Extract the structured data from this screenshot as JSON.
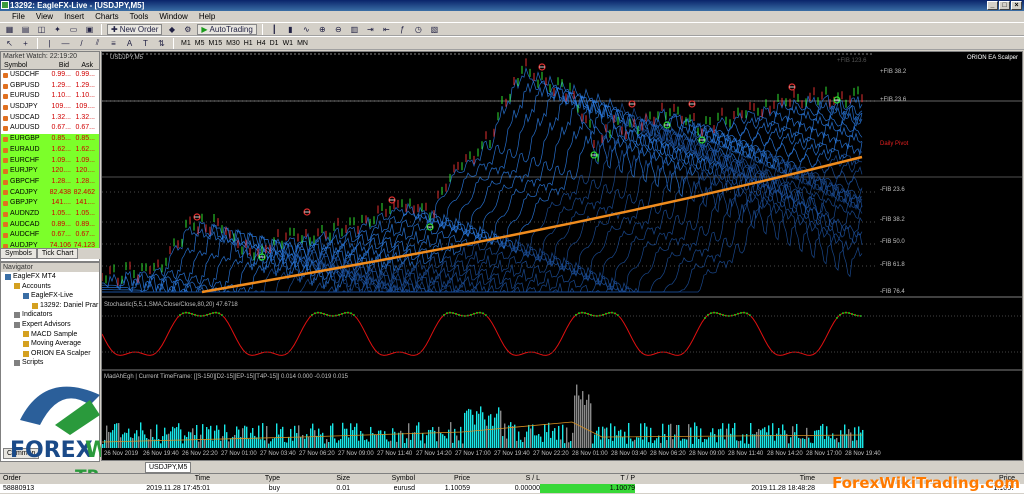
{
  "window": {
    "title": "13292: EagleFX-Live - [USDJPY,M5]"
  },
  "menu": [
    "File",
    "View",
    "Insert",
    "Charts",
    "Tools",
    "Window",
    "Help"
  ],
  "toolbar": {
    "new_order": "New Order",
    "autotrading": "AutoTrading",
    "timeframes": [
      "M1",
      "M5",
      "M15",
      "M30",
      "H1",
      "H4",
      "D1",
      "W1",
      "MN"
    ]
  },
  "market_watch": {
    "title": "Market Watch: 22:19:20",
    "columns": {
      "symbol": "Symbol",
      "bid": "Bid",
      "ask": "Ask"
    },
    "rows": [
      {
        "symbol": "USDCHF",
        "bid": "0.99...",
        "ask": "0.99...",
        "hl": false
      },
      {
        "symbol": "GBPUSD",
        "bid": "1.29...",
        "ask": "1.29...",
        "hl": false
      },
      {
        "symbol": "EURUSD",
        "bid": "1.10...",
        "ask": "1.10...",
        "hl": false
      },
      {
        "symbol": "USDJPY",
        "bid": "109....",
        "ask": "109....",
        "hl": false
      },
      {
        "symbol": "USDCAD",
        "bid": "1.32...",
        "ask": "1.32...",
        "hl": false
      },
      {
        "symbol": "AUDUSD",
        "bid": "0.67...",
        "ask": "0.67...",
        "hl": false
      },
      {
        "symbol": "EURGBP",
        "bid": "0.85...",
        "ask": "0.85...",
        "hl": true
      },
      {
        "symbol": "EURAUD",
        "bid": "1.62...",
        "ask": "1.62...",
        "hl": true
      },
      {
        "symbol": "EURCHF",
        "bid": "1.09...",
        "ask": "1.09...",
        "hl": true
      },
      {
        "symbol": "EURJPY",
        "bid": "120....",
        "ask": "120....",
        "hl": true
      },
      {
        "symbol": "GBPCHF",
        "bid": "1.28...",
        "ask": "1.28...",
        "hl": true
      },
      {
        "symbol": "CADJPY",
        "bid": "82.438",
        "ask": "82.462",
        "hl": true
      },
      {
        "symbol": "GBPJPY",
        "bid": "141....",
        "ask": "141....",
        "hl": true
      },
      {
        "symbol": "AUDNZD",
        "bid": "1.05...",
        "ask": "1.05...",
        "hl": true
      },
      {
        "symbol": "AUDCAD",
        "bid": "0.89...",
        "ask": "0.89...",
        "hl": true
      },
      {
        "symbol": "AUDCHF",
        "bid": "0.67...",
        "ask": "0.67...",
        "hl": true
      },
      {
        "symbol": "AUDJPY",
        "bid": "74.106",
        "ask": "74.123",
        "hl": true
      }
    ],
    "tabs": [
      "Symbols",
      "Tick Chart"
    ]
  },
  "navigator": {
    "title": "Navigator",
    "items": [
      {
        "label": "EagleFX MT4",
        "indent": 0
      },
      {
        "label": "Accounts",
        "indent": 1
      },
      {
        "label": "EagleFX-Live",
        "indent": 2
      },
      {
        "label": "13292: Daniel Prar",
        "indent": 3
      },
      {
        "label": "Indicators",
        "indent": 1
      },
      {
        "label": "Expert Advisors",
        "indent": 1
      },
      {
        "label": "MACD Sample",
        "indent": 2
      },
      {
        "label": "Moving Average",
        "indent": 2
      },
      {
        "label": "ORION EA Scalper",
        "indent": 2
      },
      {
        "label": "Scripts",
        "indent": 1
      }
    ],
    "tab": "Common"
  },
  "logo": {
    "text1": "FOREX",
    "text2": "WIKI",
    "text3": "TRADING"
  },
  "chart": {
    "symbol_label": "USDJPY,M5",
    "ea_label": "ORION EA Scalper",
    "daily_pivot": "Daily Pivot",
    "fib_labels": [
      "+FIB 123.6",
      "+FIB 38.2",
      "+FIB 23.6",
      "-FIB 23.6",
      "-FIB 38.2",
      "-FIB 50.0",
      "-FIB 61.8",
      "-FIB 76.4"
    ],
    "stoch_label": "Stochastic(5,5,1,SMA,Close/Close,80,20) 47.6718",
    "subwin_label": "MadAhEgh | Current TimeFrame: [[S-150][D2-15][EP-15][T4P-15]] 0.014 0.000 -0.019 0.015",
    "time_labels": [
      "26 Nov 2019",
      "26 Nov 19:40",
      "26 Nov 22:20",
      "27 Nov 01:00",
      "27 Nov 03:40",
      "27 Nov 06:20",
      "27 Nov 09:00",
      "27 Nov 11:40",
      "27 Nov 14:20",
      "27 Nov 17:00",
      "27 Nov 19:40",
      "27 Nov 22:20",
      "28 Nov 01:00",
      "28 Nov 03:40",
      "28 Nov 06:20",
      "28 Nov 09:00",
      "28 Nov 11:40",
      "28 Nov 14:20",
      "28 Nov 17:00",
      "28 Nov 19:40"
    ],
    "tab": "USDJPY,M5",
    "colors": {
      "bg": "#000000",
      "ribbon": "#1e6bd6",
      "ma": "#f08c1e",
      "stoch_up": "#18c418",
      "stoch_down": "#e01010",
      "hist": "#18e8e8"
    }
  },
  "terminal": {
    "columns": [
      "Order",
      "Time",
      "Type",
      "Size",
      "Symbol",
      "Price",
      "S / L",
      "T / P",
      "Time",
      "Price"
    ],
    "row": [
      "58880913",
      "2019.11.28 17:45:01",
      "buy",
      "0.01",
      "eurusd",
      "1.10059",
      "0.00000",
      "1.10079",
      "2019.11.28 18:48:28",
      "1.1007"
    ]
  },
  "watermark": "ForexWikiTrading.com"
}
